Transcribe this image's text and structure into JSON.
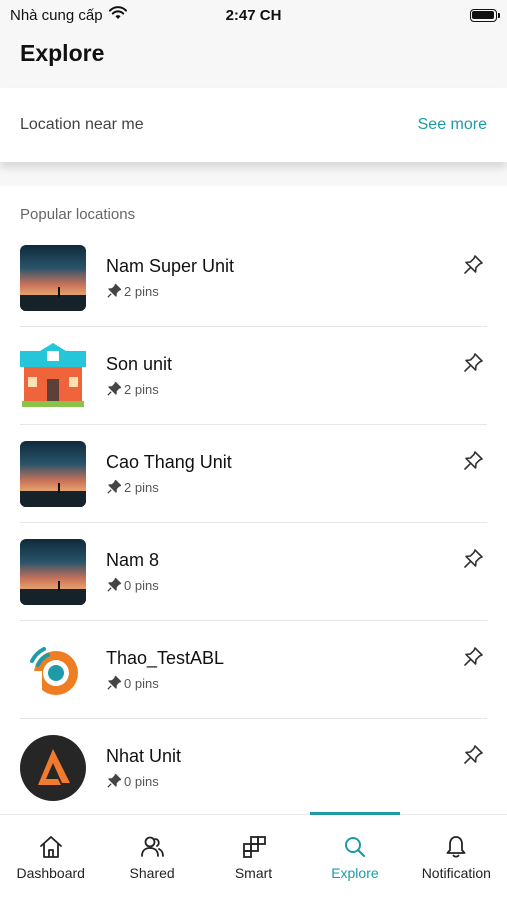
{
  "status_bar": {
    "carrier": "Nhà cung cấp",
    "time": "2:47 CH"
  },
  "header": {
    "title": "Explore"
  },
  "near_me": {
    "title": "Location near me",
    "see_more": "See more"
  },
  "popular": {
    "title": "Popular locations",
    "items": [
      {
        "name": "Nam Super Unit",
        "pins": "2 pins",
        "thumb": "sunset-photo"
      },
      {
        "name": "Son unit",
        "pins": "2 pins",
        "thumb": "house-illustration"
      },
      {
        "name": "Cao Thang Unit",
        "pins": "2 pins",
        "thumb": "sunset-photo"
      },
      {
        "name": "Nam 8",
        "pins": "0 pins",
        "thumb": "sunset-photo"
      },
      {
        "name": "Thao_TestABL",
        "pins": "0 pins",
        "thumb": "orange-signal-logo"
      },
      {
        "name": "Nhat Unit",
        "pins": "0 pins",
        "thumb": "dark-circle-logo"
      }
    ]
  },
  "tabs": [
    {
      "label": "Dashboard",
      "icon": "home-icon"
    },
    {
      "label": "Shared",
      "icon": "people-icon"
    },
    {
      "label": "Smart",
      "icon": "blocks-icon"
    },
    {
      "label": "Explore",
      "icon": "search-icon",
      "active": true
    },
    {
      "label": "Notification",
      "icon": "bell-icon"
    }
  ],
  "colors": {
    "accent": "#1e9aa8",
    "text": "#111111",
    "secondary": "#555555"
  }
}
